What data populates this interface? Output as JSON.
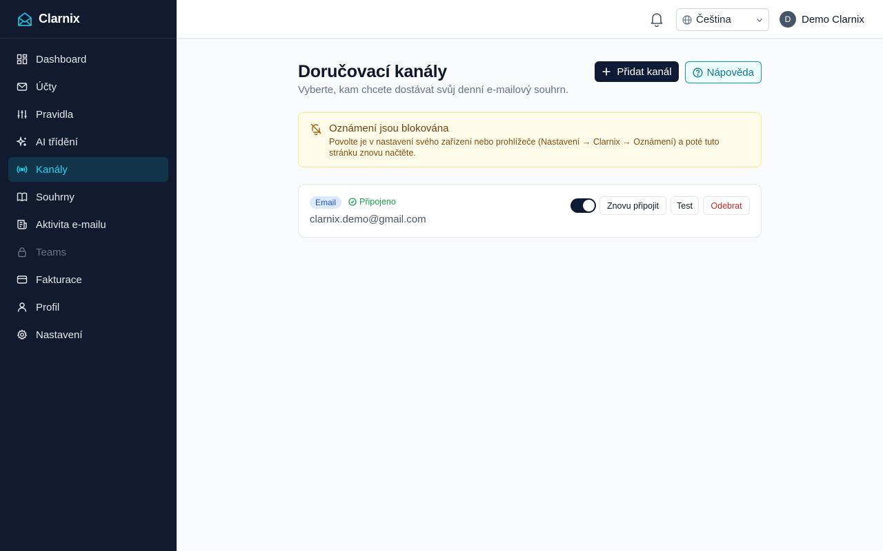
{
  "brand": {
    "name": "Clarnix"
  },
  "sidebar": {
    "items": [
      {
        "label": "Dashboard",
        "icon": "dashboard-icon"
      },
      {
        "label": "Účty",
        "icon": "mail-icon"
      },
      {
        "label": "Pravidla",
        "icon": "sliders-icon"
      },
      {
        "label": "AI třídění",
        "icon": "sparkles-icon"
      },
      {
        "label": "Kanály",
        "icon": "broadcast-icon",
        "active": true
      },
      {
        "label": "Souhrny",
        "icon": "book-icon"
      },
      {
        "label": "Aktivita e-mailu",
        "icon": "receipt-icon"
      },
      {
        "label": "Teams",
        "icon": "lock-icon",
        "disabled": true
      },
      {
        "label": "Fakturace",
        "icon": "credit-card-icon"
      },
      {
        "label": "Profil",
        "icon": "user-icon"
      },
      {
        "label": "Nastavení",
        "icon": "gear-icon"
      }
    ]
  },
  "header": {
    "language": "Čeština",
    "user_initial": "D",
    "user_name": "Demo Clarnix"
  },
  "page": {
    "title": "Doručovací kanály",
    "subtitle": "Vyberte, kam chcete dostávat svůj denní e-mailový souhrn.",
    "add_button": "Přidat kanál",
    "help_button": "Nápověda"
  },
  "alert": {
    "title": "Oznámení jsou blokována",
    "text": "Povolte je v nastavení svého zařízení nebo prohlížeče (Nastavení → Clarnix → Oznámení) a poté tuto stránku znovu načtěte."
  },
  "channel": {
    "type": "Email",
    "status": "Připojeno",
    "address": "clarnix.demo@gmail.com",
    "enabled": true,
    "reconnect": "Znovu připojit",
    "test": "Test",
    "remove": "Odebrat"
  },
  "colors": {
    "sidebar_bg": "#111a2e",
    "active_bg": "#12344a",
    "accent": "#22d3ee",
    "primary": "#0f1b35",
    "danger": "#dc2626",
    "success": "#16a34a"
  }
}
